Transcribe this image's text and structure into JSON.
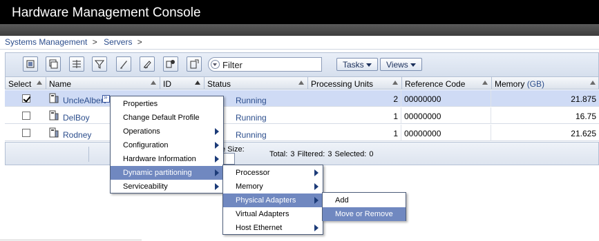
{
  "app": {
    "title": "Hardware Management Console"
  },
  "breadcrumb": [
    "Systems Management",
    "Servers"
  ],
  "breadcrumb_separator": ">",
  "toolbar": {
    "icons": [
      "select-all-icon",
      "deselect-all-icon",
      "filter-rows-icon",
      "clear-filter-icon",
      "edit-sort-icon",
      "clear-sort-icon",
      "configure-columns-icon",
      "view-settings-icon"
    ],
    "filter_placeholder": "Filter",
    "tasks_label": "Tasks",
    "views_label": "Views"
  },
  "table": {
    "headers": {
      "select": "Select",
      "name": "Name",
      "id": "ID",
      "status": "Status",
      "processing_units": "Processing Units",
      "reference_code": "Reference Code",
      "memory": "Memory",
      "memory_unit": "(GB)"
    },
    "rows": [
      {
        "selected": true,
        "name": "UncleAlbert",
        "status": "Running",
        "processing_units": "2",
        "reference_code": "00000000",
        "memory": "21.875"
      },
      {
        "selected": false,
        "name": "DelBoy",
        "status": "Running",
        "processing_units": "1",
        "reference_code": "00000000",
        "memory": "16.75"
      },
      {
        "selected": false,
        "name": "Rodney",
        "status": "Running",
        "processing_units": "1",
        "reference_code": "00000000",
        "memory": "21.625"
      }
    ],
    "footer": {
      "page_size_label": "e Size:",
      "totals": "Total: 3   Filtered: 3   Selected: 0"
    }
  },
  "context_menu": {
    "items": [
      "Properties",
      "Change Default Profile",
      "Operations",
      "Configuration",
      "Hardware Information",
      "Dynamic partitioning",
      "Serviceability"
    ],
    "highlighted": "Dynamic partitioning"
  },
  "submenu_dlpar": {
    "items": [
      "Processor",
      "Memory",
      "Physical Adapters",
      "Virtual Adapters",
      "Host Ethernet"
    ],
    "highlighted": "Physical Adapters"
  },
  "submenu_physical": {
    "items": [
      "Add",
      "Move or Remove"
    ],
    "highlighted": "Move or Remove"
  },
  "colors": {
    "accent": "#7088c0",
    "link": "#2b4d8c",
    "selected_row": "#cfdbf5"
  }
}
